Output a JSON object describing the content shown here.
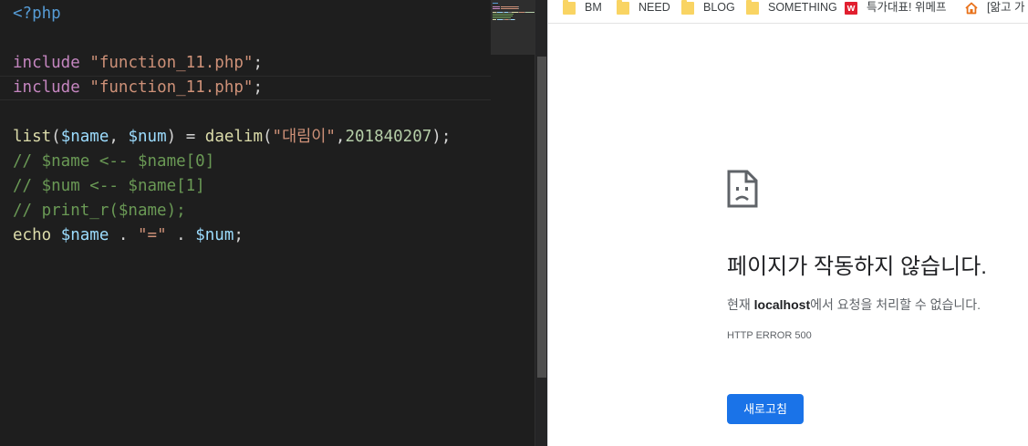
{
  "editor": {
    "lines": [
      {
        "tokens": [
          {
            "t": "<?php",
            "c": "tag"
          }
        ]
      },
      {
        "tokens": []
      },
      {
        "tokens": [
          {
            "t": "include",
            "c": "kw"
          },
          {
            "t": " ",
            "c": "pl"
          },
          {
            "t": "\"function_11.php\"",
            "c": "str"
          },
          {
            "t": ";",
            "c": "pl"
          }
        ]
      },
      {
        "tokens": [
          {
            "t": "include",
            "c": "kw"
          },
          {
            "t": " ",
            "c": "pl"
          },
          {
            "t": "\"function_11.php\"",
            "c": "str"
          },
          {
            "t": ";",
            "c": "pl"
          }
        ]
      },
      {
        "tokens": []
      },
      {
        "tokens": [
          {
            "t": "list",
            "c": "fn"
          },
          {
            "t": "(",
            "c": "pl"
          },
          {
            "t": "$name",
            "c": "var"
          },
          {
            "t": ", ",
            "c": "pl"
          },
          {
            "t": "$num",
            "c": "var"
          },
          {
            "t": ") = ",
            "c": "pl"
          },
          {
            "t": "daelim",
            "c": "fn"
          },
          {
            "t": "(",
            "c": "pl"
          },
          {
            "t": "\"대림이\"",
            "c": "str"
          },
          {
            "t": ",",
            "c": "pl"
          },
          {
            "t": "201840207",
            "c": "num"
          },
          {
            "t": ");",
            "c": "pl"
          }
        ]
      },
      {
        "tokens": [
          {
            "t": "// $name <-- $name[0]",
            "c": "cmt"
          }
        ]
      },
      {
        "tokens": [
          {
            "t": "// $num <-- $name[1]",
            "c": "cmt"
          }
        ]
      },
      {
        "tokens": [
          {
            "t": "// print_r($name);",
            "c": "cmt"
          }
        ]
      },
      {
        "tokens": [
          {
            "t": "echo",
            "c": "fn"
          },
          {
            "t": " ",
            "c": "pl"
          },
          {
            "t": "$name",
            "c": "var"
          },
          {
            "t": " . ",
            "c": "pl"
          },
          {
            "t": "\"=\"",
            "c": "str"
          },
          {
            "t": " . ",
            "c": "pl"
          },
          {
            "t": "$num",
            "c": "var"
          },
          {
            "t": ";",
            "c": "pl"
          }
        ]
      }
    ]
  },
  "bookmarks": [
    {
      "label": "BM",
      "icon": "folder-icon"
    },
    {
      "label": "NEED",
      "icon": "folder-icon"
    },
    {
      "label": "BLOG",
      "icon": "folder-icon"
    },
    {
      "label": "SOMETHING",
      "icon": "folder-icon"
    },
    {
      "label": "특가대표! 위메프",
      "icon": "wemakeprice-icon"
    },
    {
      "label": "[앎고 가",
      "icon": "house-icon"
    }
  ],
  "error_page": {
    "icon": "sad-page-icon",
    "title": "페이지가 작동하지 않습니다.",
    "desc_prefix": "현재 ",
    "desc_host": "localhost",
    "desc_suffix": "에서 요청을 처리할 수 없습니다.",
    "code": "HTTP ERROR 500",
    "reload_label": "새로고침"
  },
  "colors": {
    "editor_bg": "#1e1e1e",
    "keyword": "#c586c0",
    "string": "#ce9178",
    "variable": "#9cdcfe",
    "function": "#dcdcaa",
    "number": "#b5cea8",
    "comment": "#6a9955",
    "tag": "#569cd6",
    "button_blue": "#1a73e8"
  }
}
